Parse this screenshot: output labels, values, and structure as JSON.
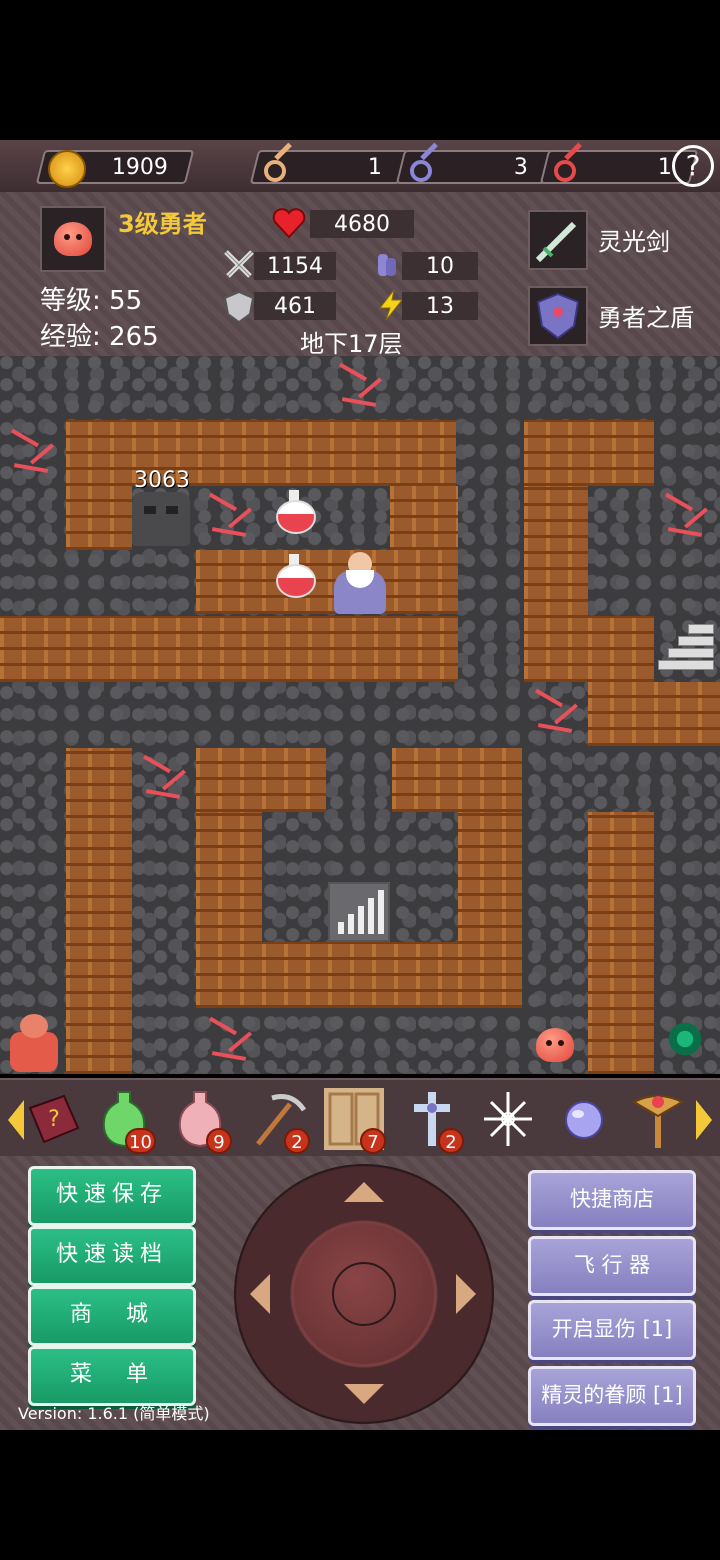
{
  "topbar": {
    "gold": "1909",
    "yellow_keys": "1",
    "blue_keys": "3",
    "red_keys": "1",
    "help_label": "?"
  },
  "hero": {
    "title": "3级勇者",
    "level_label": "等级:",
    "level": "55",
    "exp_label": "经验:",
    "exp": "265",
    "hp": "4680",
    "attack": "1154",
    "defense": "461",
    "magic_def": "10",
    "speed": "13",
    "floor": "地下17层",
    "weapon": "灵光剑",
    "armor": "勇者之盾"
  },
  "map": {
    "enemy_damage": "3063"
  },
  "items": [
    {
      "icon": "monster-book-icon",
      "count": ""
    },
    {
      "icon": "green-vase-icon",
      "count": "10"
    },
    {
      "icon": "pink-vase-icon",
      "count": "9"
    },
    {
      "icon": "pickaxe-icon",
      "count": "2"
    },
    {
      "icon": "door-icon",
      "count": "7"
    },
    {
      "icon": "cross-icon",
      "count": "2"
    },
    {
      "icon": "snowflake-icon",
      "count": ""
    },
    {
      "icon": "orb-icon",
      "count": ""
    },
    {
      "icon": "staff-icon",
      "count": ""
    }
  ],
  "controls": {
    "quick_save": "快速保存",
    "quick_load": "快速读档",
    "shop": "商　城",
    "menu": "菜　单",
    "quick_shop": "快捷商店",
    "flyer": "飞 行 器",
    "show_damage": "开启显伤 [1]",
    "fairy_favor": "精灵的眷顾 [1]",
    "version": "Version: 1.6.1 (简单模式)"
  },
  "colors": {
    "gold_text": "#f3c93a",
    "green_button": "#1fae78",
    "purple_button": "#9690cc",
    "badge_red": "#c8331c"
  }
}
